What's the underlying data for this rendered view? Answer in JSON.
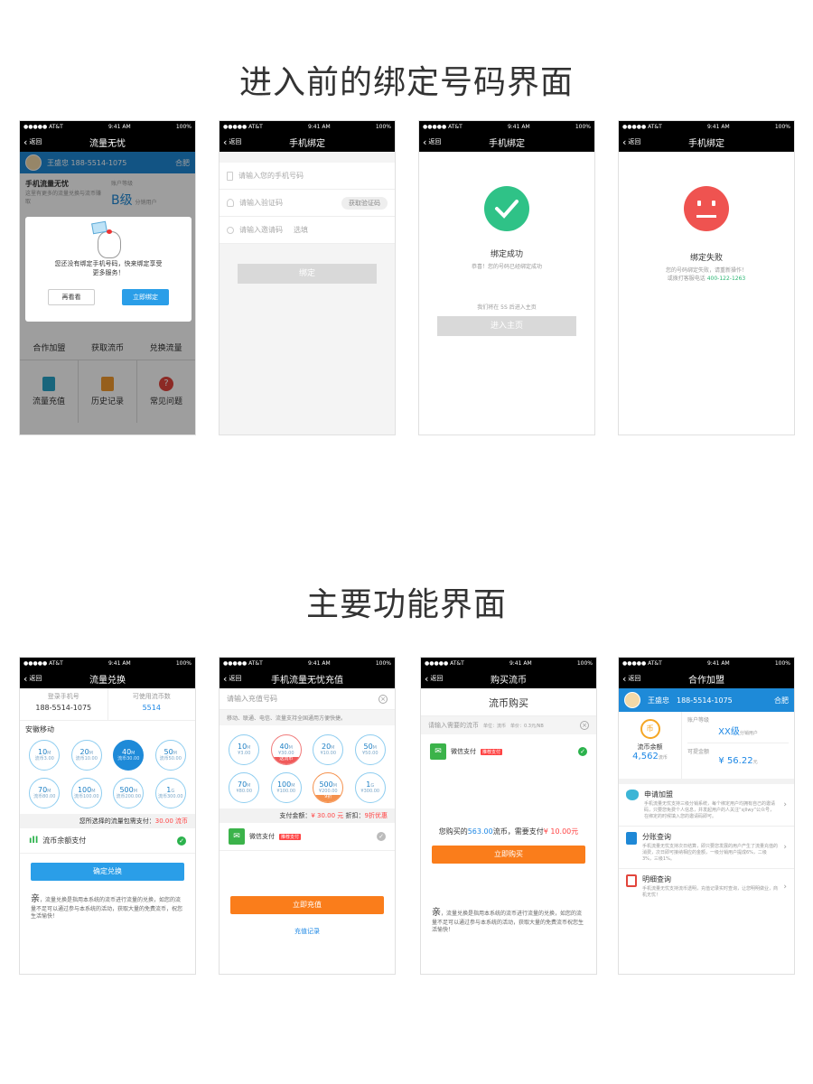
{
  "section1_title": "进入前的绑定号码界面",
  "section2_title": "主要功能界面",
  "status": {
    "carrier": "●●●●● AT&T",
    "time": "9:41 AM",
    "battery": "100%"
  },
  "back_label": "返回",
  "p1": {
    "title": "流量无忧",
    "user": "王盛忠 188-5514-1075",
    "city": "合肥",
    "product_title": "手机流量无忧",
    "product_desc": "这里有更多的流量兑换与流币赚取",
    "level_label": "账户等级",
    "level": "B级",
    "level_sub": "分销用户",
    "modal_text": "您还没有绑定手机号码，快来绑定享受更多服务！",
    "modal_later": "再看看",
    "modal_bind": "立即绑定",
    "grid1": [
      "合作加盟",
      "获取流币",
      "兑换流量"
    ],
    "grid2": [
      "流量充值",
      "历史记录",
      "常见问题"
    ]
  },
  "p2": {
    "title": "手机绑定",
    "phone_ph": "请输入您的手机号码",
    "code_ph": "请输入验证码",
    "get_code": "获取验证码",
    "invite_ph": "请输入邀请码",
    "invite_opt": "选填",
    "bind_btn": "绑定"
  },
  "p3": {
    "title": "手机绑定",
    "result": "绑定成功",
    "desc": "恭喜！您的号码已经绑定成功",
    "countdown": "我们将在 5S 后进入主页",
    "enter_btn": "进入主页"
  },
  "p4": {
    "title": "手机绑定",
    "result": "绑定失败",
    "desc1": "您的号码绑定失败，请重新操作！",
    "desc2": "或拨打客服电话",
    "phone": "400-122-1263"
  },
  "p5": {
    "title": "流量兑换",
    "phone_label": "登录手机号",
    "phone": "188-5514-1075",
    "coin_label": "可使用流币数",
    "coin": "5514",
    "operator": "安徽移动",
    "packs": [
      {
        "size": "10",
        "unit": "M",
        "price": "流币3.00"
      },
      {
        "size": "20",
        "unit": "M",
        "price": "流币10.00"
      },
      {
        "size": "40",
        "unit": "M",
        "price": "流币30.00"
      },
      {
        "size": "50",
        "unit": "M",
        "price": "流币50.00"
      },
      {
        "size": "70",
        "unit": "M",
        "price": "流币80.00"
      },
      {
        "size": "100",
        "unit": "M",
        "price": "流币100.00"
      },
      {
        "size": "500",
        "unit": "M",
        "price": "流币200.00"
      },
      {
        "size": "1",
        "unit": "G",
        "price": "流币300.00"
      }
    ],
    "need_text": "您所选择的流量包需支付：",
    "need_value": "30.00 流币",
    "pay_method": "流币余额支付",
    "confirm_btn": "确定兑换",
    "note_big": "亲",
    "note": "，流量兑换是指用本系统的流币进行流量的兑换，如您的流量不足可以通过参与本系统的活动，获取大量的免费流币，祝您生活愉快！"
  },
  "p6": {
    "title": "手机流量无忧充值",
    "phone_ph": "请输入充值号码",
    "tip": "移动、联通、电信、流量支持全国通用方便快捷。",
    "packs": [
      {
        "size": "10",
        "unit": "M",
        "price": "¥3.00"
      },
      {
        "size": "40",
        "unit": "M",
        "price": "¥30.00"
      },
      {
        "size": "20",
        "unit": "M",
        "price": "¥10.00"
      },
      {
        "size": "50",
        "unit": "M",
        "price": "¥50.00"
      },
      {
        "size": "70",
        "unit": "M",
        "price": "¥80.00"
      },
      {
        "size": "100",
        "unit": "M",
        "price": "¥100.00"
      },
      {
        "size": "500",
        "unit": "M",
        "price": "¥200.00"
      },
      {
        "size": "1",
        "unit": "G",
        "price": "¥300.00"
      }
    ],
    "tag_coin": "送流币",
    "tag_discount": "9折",
    "pay_label": "支付金额：",
    "pay_value": "¥ 30.00 元",
    "discount_label": "折扣：",
    "discount_value": "9折优惠",
    "wechat_label": "微信支付",
    "recommend": "推荐支付",
    "charge_btn": "立即充值",
    "history_link": "充值记录"
  },
  "p7": {
    "title": "购买流币",
    "heading": "流币购买",
    "input_ph": "请输入需要的流币",
    "unit_label": "单位：流币",
    "price_label": "单价：0.3元/NB",
    "wechat_label": "微信支付",
    "recommend": "推荐支付",
    "buy_text1": "您购买的",
    "buy_coin": "563.00",
    "buy_text2": "流币，需要支付",
    "buy_price": "¥ 10.00元",
    "buy_btn": "立即购买",
    "note_big": "亲",
    "note": "，流量兑换是指用本系统的流币进行流量的兑换，如您的流量不足可以通过参与本系统的活动，获取大量的免费流币祝您生活愉快！"
  },
  "p8": {
    "title": "合作加盟",
    "user": "王盛忠",
    "phone": "188-5514-1075",
    "city": "合肥",
    "coin_label": "流币余额",
    "coin": "4,562",
    "coin_unit": "流币",
    "level_label": "账户等级",
    "level": "XX级",
    "level_sub": "分销用户",
    "cash_label": "可提金额",
    "cash": "¥ 56.22",
    "cash_unit": "元",
    "items": [
      {
        "title": "申请加盟",
        "desc": "手机流量无忧支持三级分销系统，每个绑定用户均拥有自己的邀请码，只要您免费个人信息，并发起用户的人关注“sjllwy”公众号，在绑定的时候填入您的邀请码即可。"
      },
      {
        "title": "分账查询",
        "desc": "手机流量无忧支持次日结算，即只要您发展的用户产生了流量充值的消费，次日即可接纳相应的金额，一级分销用户提成6%，二级3%，三级1%。"
      },
      {
        "title": "明细查询",
        "desc": "手机流量无忧支持流币透明，充值记录实时查询，让您明明做业，商机无忧！"
      }
    ]
  }
}
